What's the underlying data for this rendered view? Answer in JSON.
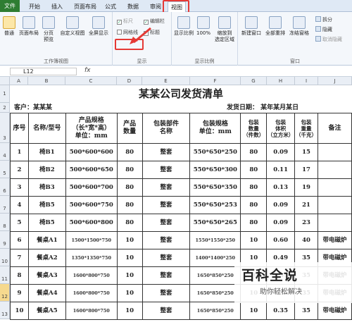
{
  "tabs": [
    "文件",
    "开始",
    "插入",
    "页面布局",
    "公式",
    "数据",
    "审阅",
    "视图"
  ],
  "ribbon": {
    "workbook_views": {
      "label": "工作簿视图",
      "buttons": [
        "普通",
        "页面布局",
        "分页\n预览",
        "自定义视图",
        "全屏显示"
      ]
    },
    "show": {
      "label": "显示",
      "items": [
        {
          "text": "标尺",
          "checked": true
        },
        {
          "text": "编辑栏",
          "checked": true
        },
        {
          "text": "网格线",
          "checked": false
        },
        {
          "text": "标题",
          "checked": true
        }
      ]
    },
    "zoom": {
      "label": "显示比例",
      "buttons": [
        "显示比例",
        "100%",
        "缩放到\n选定区域"
      ]
    },
    "window": {
      "label": "窗口",
      "buttons": [
        "新建窗口",
        "全部重排",
        "冻结窗格"
      ],
      "small": [
        "拆分",
        "隐藏",
        "取消隐藏"
      ]
    }
  },
  "formula_bar": {
    "name_box": "L12",
    "fx": "fx"
  },
  "columns": [
    "A",
    "B",
    "C",
    "D",
    "E",
    "F",
    "G",
    "H",
    "I",
    "J"
  ],
  "row_numbers": [
    "1",
    "2",
    "3",
    "4",
    "5",
    "6",
    "7",
    "8",
    "9",
    "10",
    "11",
    "12",
    "13"
  ],
  "sheet": {
    "title": "某某公司发货清单",
    "customer": "客户：某某某",
    "ship_date": "发货日期：  某年某月某日",
    "header": [
      "序号",
      "名称/型号",
      "产品规格\n（长*宽*高）\n单位：mm",
      "产品\n数量",
      "包装部件\n名称",
      "包装规格\n单位：mm",
      "包装\n数量\n（件数）",
      "包装\n体积\n（立方米）",
      "包装\n重量\n（千克）",
      "备注"
    ],
    "rows": [
      [
        "1",
        "椅B1",
        "500*600*600",
        "80",
        "整套",
        "550*650*250",
        "80",
        "0.09",
        "15",
        ""
      ],
      [
        "2",
        "椅B2",
        "500*600*650",
        "80",
        "整套",
        "550*650*300",
        "80",
        "0.11",
        "17",
        ""
      ],
      [
        "3",
        "椅B3",
        "500*600*700",
        "80",
        "整套",
        "550*650*350",
        "80",
        "0.13",
        "19",
        ""
      ],
      [
        "4",
        "椅B5",
        "500*600*750",
        "80",
        "整套",
        "550*650*253",
        "80",
        "0.09",
        "21",
        ""
      ],
      [
        "5",
        "椅B5",
        "500*600*800",
        "80",
        "整套",
        "550*650*265",
        "80",
        "0.09",
        "23",
        ""
      ],
      [
        "6",
        "餐桌A1",
        "1500*1500*750",
        "10",
        "整套",
        "1550*1550*250",
        "10",
        "0.60",
        "40",
        "带电磁炉"
      ],
      [
        "7",
        "餐桌A2",
        "1350*1350*750",
        "10",
        "整套",
        "1400*1400*250",
        "10",
        "0.49",
        "35",
        "带电磁炉"
      ],
      [
        "8",
        "餐桌A3",
        "1600*800*750",
        "10",
        "整套",
        "1650*850*250",
        "10",
        "0.35",
        "35",
        "带电磁炉"
      ],
      [
        "9",
        "餐桌A4",
        "1600*800*750",
        "10",
        "整套",
        "1650*850*250",
        "10",
        "0.35",
        "35",
        "带电磁炉"
      ],
      [
        "10",
        "餐桌A5",
        "1600*800*750",
        "10",
        "整套",
        "1650*850*250",
        "10",
        "0.35",
        "35",
        "带电磁炉"
      ]
    ]
  },
  "watermark": {
    "main": "百科全说",
    "sub": "助你轻松解决"
  },
  "colors": {
    "file_tab": "#2e7d32",
    "highlight": "#e53935",
    "header_bg": "#e9eef5"
  }
}
